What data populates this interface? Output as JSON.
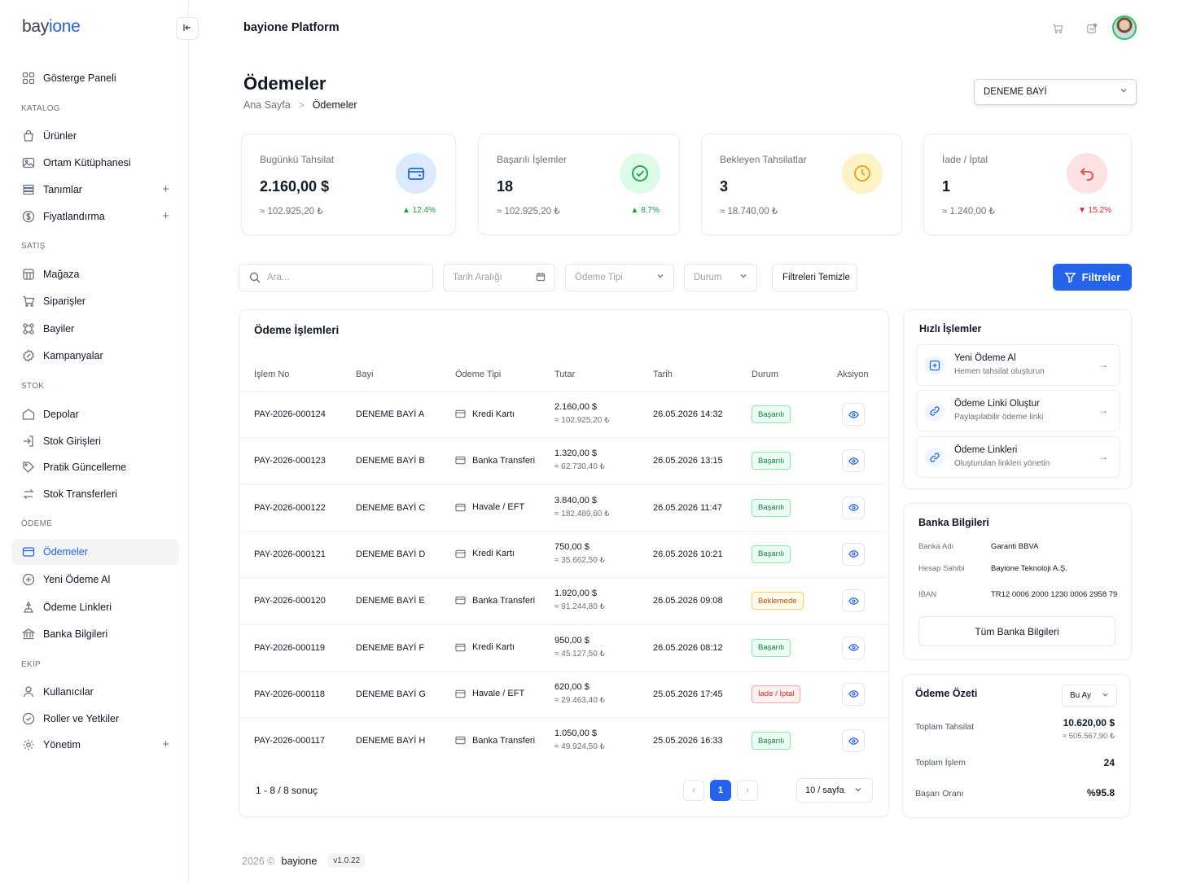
{
  "brand": {
    "part1": "bay",
    "part2": "ione"
  },
  "sidebar": {
    "items": [
      {
        "label": "Gösterge Paneli",
        "icon": "grid-icon"
      },
      {
        "label": "Ürünler",
        "icon": "bag-icon"
      },
      {
        "label": "Ortam Kütüphanesi",
        "icon": "image-icon"
      },
      {
        "label": "Tanımlar",
        "icon": "layers-icon",
        "expandable": true
      },
      {
        "label": "Fiyatlandırma",
        "icon": "dollar-icon",
        "expandable": true
      },
      {
        "label": "Mağaza",
        "icon": "store-icon"
      },
      {
        "label": "Siparişler",
        "icon": "cart-icon"
      },
      {
        "label": "Bayiler",
        "icon": "network-icon"
      },
      {
        "label": "Kampanyalar",
        "icon": "badge-icon"
      },
      {
        "label": "Depolar",
        "icon": "warehouse-icon"
      },
      {
        "label": "Stok Girişleri",
        "icon": "login-icon"
      },
      {
        "label": "Pratik Güncelleme",
        "icon": "tag-icon"
      },
      {
        "label": "Stok Transferleri",
        "icon": "swap-icon"
      },
      {
        "label": "Ödemeler",
        "icon": "card-icon",
        "active": true
      },
      {
        "label": "Yeni Ödeme Al",
        "icon": "plus-circle-icon"
      },
      {
        "label": "Ödeme Linkleri",
        "icon": "link-icon"
      },
      {
        "label": "Banka Bilgileri",
        "icon": "bank-icon"
      },
      {
        "label": "Kullanıcılar",
        "icon": "user-icon"
      },
      {
        "label": "Roller ve Yetkiler",
        "icon": "shield-check-icon"
      },
      {
        "label": "Yönetim",
        "icon": "gear-icon",
        "expandable": true
      }
    ],
    "sections": {
      "katalog": "KATALOG",
      "satis": "SATIŞ",
      "stok": "STOK",
      "odeme": "ÖDEME",
      "ekip": "EKİP"
    }
  },
  "topbar": {
    "title": "bayione Platform"
  },
  "header": {
    "title": "Ödemeler",
    "breadcrumb_home": "Ana Sayfa",
    "breadcrumb_sep": ">",
    "breadcrumb_current": "Ödemeler",
    "dealer_select": "DENEME BAYİ"
  },
  "stats": [
    {
      "label": "Bugünkü Tahsilat",
      "value": "2.160,00 $",
      "sub": "≈ 102.925,20 ₺",
      "change": "▲ 12.4%",
      "dir": "up",
      "icon": "wallet-icon",
      "color": "#2563eb"
    },
    {
      "label": "Başarılı İşlemler",
      "value": "18",
      "sub": "≈ 102.925,20 ₺",
      "change": "▲ 8.7%",
      "dir": "up",
      "icon": "check-circle-icon",
      "color": "#16a34a"
    },
    {
      "label": "Bekleyen Tahsilatlar",
      "value": "3",
      "sub": "≈ 18.740,00 ₺",
      "change": "",
      "dir": "",
      "icon": "clock-icon",
      "color": "#f59e0b"
    },
    {
      "label": "İade / İptal",
      "value": "1",
      "sub": "≈ 1.240,00 ₺",
      "change": "▼ 15.2%",
      "dir": "down",
      "icon": "undo-icon",
      "color": "#ef4444"
    }
  ],
  "filters": {
    "search_placeholder": "Ara...",
    "date_range": "Tarih Aralığı",
    "payment_type": "Ödeme Tipi",
    "status": "Durum",
    "clear": "Filtreleri Temizle",
    "filter_button": "Filtreler"
  },
  "table": {
    "title": "Ödeme İşlemleri",
    "columns": [
      "İşlem No",
      "Bayi",
      "Ödeme Tipi",
      "Tutar",
      "Tarih",
      "Durum",
      "Aksiyon"
    ],
    "rows": [
      {
        "id": "PAY-2026-000124",
        "dealer": "DENEME BAYİ A",
        "type": "Kredi Kartı",
        "amount": "2.160,00 $",
        "amount_try": "≈ 102.925,20 ₺",
        "date": "26.05.2026 14:32",
        "status": "Başarılı",
        "status_kind": "ok"
      },
      {
        "id": "PAY-2026-000123",
        "dealer": "DENEME BAYİ B",
        "type": "Banka Transferi",
        "amount": "1.320,00 $",
        "amount_try": "≈ 62.730,40 ₺",
        "date": "26.05.2026 13:15",
        "status": "Başarılı",
        "status_kind": "ok"
      },
      {
        "id": "PAY-2026-000122",
        "dealer": "DENEME BAYİ C",
        "type": "Havale / EFT",
        "amount": "3.840,00 $",
        "amount_try": "≈ 182.489,60 ₺",
        "date": "26.05.2026 11:47",
        "status": "Başarılı",
        "status_kind": "ok"
      },
      {
        "id": "PAY-2026-000121",
        "dealer": "DENEME BAYİ D",
        "type": "Kredi Kartı",
        "amount": "750,00 $",
        "amount_try": "≈ 35.662,50 ₺",
        "date": "26.05.2026 10:21",
        "status": "Başarılı",
        "status_kind": "ok"
      },
      {
        "id": "PAY-2026-000120",
        "dealer": "DENEME BAYİ E",
        "type": "Banka Transferi",
        "amount": "1.920,00 $",
        "amount_try": "≈ 91.244,80 ₺",
        "date": "26.05.2026 09:08",
        "status": "Beklemede",
        "status_kind": "wait"
      },
      {
        "id": "PAY-2026-000119",
        "dealer": "DENEME BAYİ F",
        "type": "Kredi Kartı",
        "amount": "950,00 $",
        "amount_try": "≈ 45.127,50 ₺",
        "date": "26.05.2026 08:12",
        "status": "Başarılı",
        "status_kind": "ok"
      },
      {
        "id": "PAY-2026-000118",
        "dealer": "DENEME BAYİ G",
        "type": "Havale / EFT",
        "amount": "620,00 $",
        "amount_try": "≈ 29.463,40 ₺",
        "date": "25.05.2026 17:45",
        "status": "İade / İptal",
        "status_kind": "ref"
      },
      {
        "id": "PAY-2026-000117",
        "dealer": "DENEME BAYİ H",
        "type": "Banka Transferi",
        "amount": "1.050,00 $",
        "amount_try": "≈ 49.924,50 ₺",
        "date": "25.05.2026 16:33",
        "status": "Başarılı",
        "status_kind": "ok"
      }
    ],
    "pager_info": "1 - 8 / 8 sonuç",
    "current_page": "1",
    "per_page": "10 / sayfa"
  },
  "quick_actions": {
    "title": "Hızlı İşlemler",
    "items": [
      {
        "title": "Yeni Ödeme Al",
        "desc": "Hemen tahsilat oluşturun",
        "icon": "plus-square-icon"
      },
      {
        "title": "Ödeme Linki Oluştur",
        "desc": "Paylaşılabilir ödeme linki",
        "icon": "link-icon"
      },
      {
        "title": "Ödeme Linkleri",
        "desc": "Oluşturulan linkleri yönetin",
        "icon": "link-icon"
      }
    ]
  },
  "bank": {
    "title": "Banka Bilgileri",
    "bank_name_label": "Banka Adı",
    "bank_name": "Garanti BBVA",
    "holder_label": "Hesap Sahibi",
    "holder": "Bayione Teknoloji A.Ş.",
    "iban_label": "IBAN",
    "iban": "TR12 0006 2000 1230 0006 2958 79",
    "button": "Tüm Banka Bilgileri"
  },
  "summary": {
    "title": "Ödeme Özeti",
    "period": "Bu Ay",
    "total_label": "Toplam Tahsilat",
    "total": "10.620,00 $",
    "total_try": "≈ 505.567,90 ₺",
    "count_label": "Toplam İşlem",
    "count": "24",
    "rate_label": "Başarı Oranı",
    "rate": "%95.8"
  },
  "footer": {
    "year": "2026 ©",
    "brand": "bayione",
    "version": "v1.0.22"
  },
  "colors": {
    "accent": "#2563eb",
    "success": "#16a34a",
    "warning": "#f59e0b",
    "danger": "#ef4444"
  }
}
